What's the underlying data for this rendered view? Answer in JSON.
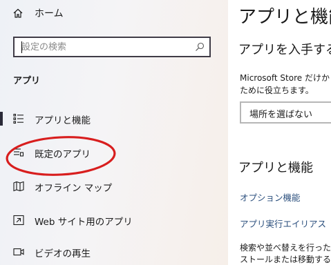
{
  "nav": {
    "home_label": "ホーム",
    "search": {
      "placeholder": "設定の検索",
      "value": ""
    },
    "section_title": "アプリ",
    "items": [
      {
        "label": "アプリと機能",
        "icon": "apps-features-icon",
        "active": true
      },
      {
        "label": "既定のアプリ",
        "icon": "default-apps-icon",
        "active": false,
        "circled_in_red": true
      },
      {
        "label": "オフライン マップ",
        "icon": "offline-maps-icon",
        "active": false
      },
      {
        "label": "Web サイト用のアプリ",
        "icon": "apps-for-websites-icon",
        "active": false
      },
      {
        "label": "ビデオの再生",
        "icon": "video-playback-icon",
        "active": false
      }
    ]
  },
  "content": {
    "title": "アプリと機能",
    "get_apps_heading": "アプリを入手する",
    "description_line1": "Microsoft Store だけか",
    "description_line2": "ために役立ちます。",
    "dropdown_selected": "場所を選ばない",
    "apps_features_heading": "アプリと機能",
    "links": [
      "オプション機能",
      "アプリ実行エイリアス"
    ],
    "footer_line1": "検索や並べ替えを行った",
    "footer_line2": "ストールまたは移動する場"
  },
  "colors": {
    "annotation_red": "#d81e1e",
    "link_blue": "#2b4f7d",
    "active_indicator": "#2a2a38"
  }
}
